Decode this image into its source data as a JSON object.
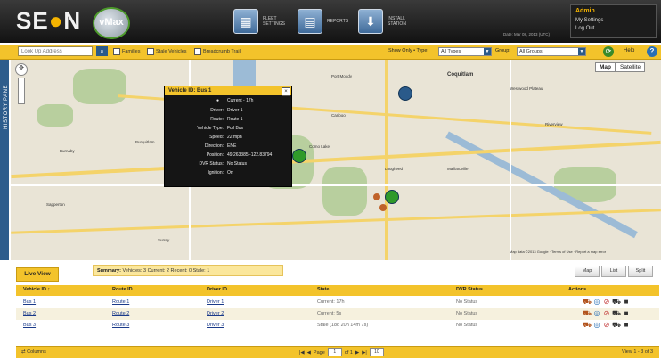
{
  "header": {
    "brand": "SEON",
    "product": "vMax",
    "nav": [
      {
        "label": "FLEET SETTINGS",
        "icon": "grid-icon"
      },
      {
        "label": "REPORTS",
        "icon": "report-icon"
      },
      {
        "label": "INSTALL STATION",
        "icon": "install-icon"
      }
    ],
    "user": {
      "name": "Admin",
      "settings": "My Settings",
      "logout": "Log Out"
    },
    "datetime": "Date: Mar 08, 2013 (UTC)"
  },
  "toolbar": {
    "search_placeholder": "Look Up Address",
    "filters": [
      "Families",
      "Stale Vehicles",
      "Breadcrumb Trail"
    ],
    "show_only_label": "Show Only • Type:",
    "type_value": "All Types",
    "group_label": "Group:",
    "group_value": "All Groups",
    "help": "Help"
  },
  "side": {
    "history_label": "HISTORY PANE"
  },
  "map": {
    "type_buttons": [
      "Map",
      "Satellite"
    ],
    "places": [
      "Coquitlam",
      "Burnaby",
      "Port Moody",
      "Sapperton",
      "Cariboo",
      "Lougheed",
      "Maillardville",
      "Como Lake",
      "Burquitlam",
      "Westwood Plateau",
      "Riverview",
      "Surrey"
    ],
    "footer": "Map data ©2013 Google · Terms of Use · Report a map error"
  },
  "popup": {
    "title": "Vehicle ID: Bus 1",
    "rows": [
      {
        "k": "",
        "v": "Current - 17h"
      },
      {
        "k": "Driver:",
        "v": "Driver 1"
      },
      {
        "k": "Route:",
        "v": "Route 1"
      },
      {
        "k": "Vehicle Type:",
        "v": "Full Bus"
      },
      {
        "k": "Speed:",
        "v": "22 mph"
      },
      {
        "k": "Direction:",
        "v": "ENE"
      },
      {
        "k": "Position:",
        "v": "49.263385,-122.83794"
      },
      {
        "k": "DVR Status:",
        "v": "No Status"
      },
      {
        "k": "Ignition:",
        "v": "On"
      }
    ]
  },
  "bottom": {
    "tab": "Live View",
    "summary_label": "Summary:",
    "summary_text": "Vehicles: 3 Current: 2 Recent: 0 Stale: 1",
    "buttons": [
      "Map",
      "List",
      "Split"
    ],
    "columns": [
      "Vehicle ID ↑",
      "Route ID",
      "Driver ID",
      "State",
      "DVR Status",
      "Actions"
    ],
    "rows": [
      {
        "vehicle": "Bus 1",
        "route": "Route 1",
        "driver": "Driver 1",
        "state": "Current: 17h",
        "dvr": "No Status"
      },
      {
        "vehicle": "Bus 2",
        "route": "Route 2",
        "driver": "Driver 2",
        "state": "Current: 5s",
        "dvr": "No Status"
      },
      {
        "vehicle": "Bus 3",
        "route": "Route 3",
        "driver": "Driver 3",
        "state": "Stale (18d 20h 14m 7s)",
        "dvr": "No Status"
      }
    ],
    "columns_link": "Columns",
    "page_label": "Page",
    "page_value": "1",
    "of_label": "of 1",
    "per_page": "10",
    "view_count": "View 1 - 3 of 3"
  }
}
